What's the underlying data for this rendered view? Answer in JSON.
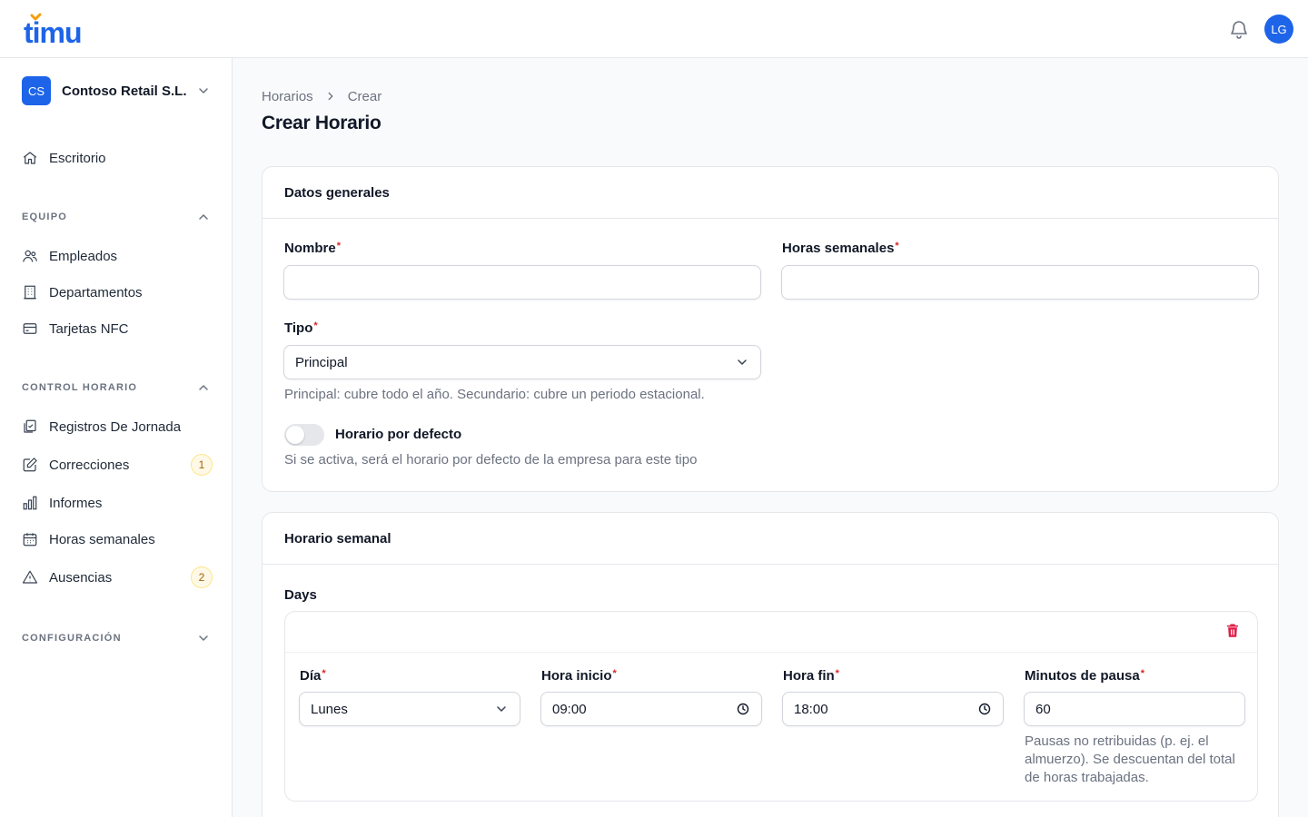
{
  "app": {
    "logo_text": "timu",
    "user_initials": "LG"
  },
  "sidebar": {
    "company": {
      "initials": "CS",
      "name": "Contoso Retail S.L."
    },
    "top_items": [
      {
        "label": "Escritorio",
        "icon": "home-icon"
      }
    ],
    "sections": [
      {
        "title": "EQUIPO",
        "expanded": true,
        "items": [
          {
            "label": "Empleados",
            "icon": "users-icon"
          },
          {
            "label": "Departamentos",
            "icon": "building-icon"
          },
          {
            "label": "Tarjetas NFC",
            "icon": "credit-card-icon"
          }
        ]
      },
      {
        "title": "CONTROL HORARIO",
        "expanded": true,
        "items": [
          {
            "label": "Registros De Jornada",
            "icon": "clipboard-check-icon"
          },
          {
            "label": "Correcciones",
            "icon": "pencil-square-icon",
            "badge": "1"
          },
          {
            "label": "Informes",
            "icon": "bar-chart-icon"
          },
          {
            "label": "Horas semanales",
            "icon": "calendar-icon"
          },
          {
            "label": "Ausencias",
            "icon": "warning-triangle-icon",
            "badge": "2"
          }
        ]
      },
      {
        "title": "CONFIGURACIÓN",
        "expanded": false,
        "items": []
      }
    ]
  },
  "breadcrumb": [
    "Horarios",
    "Crear"
  ],
  "page_title": "Crear Horario",
  "general": {
    "title": "Datos generales",
    "nombre": {
      "label": "Nombre",
      "value": ""
    },
    "horas_semanales": {
      "label": "Horas semanales",
      "value": ""
    },
    "tipo": {
      "label": "Tipo",
      "value": "Principal",
      "help": "Principal: cubre todo el año. Secundario: cubre un periodo estacional."
    },
    "default_toggle": {
      "label": "Horario por defecto",
      "checked": false,
      "help": "Si se activa, será el horario por defecto de la empresa para este tipo"
    }
  },
  "weekly": {
    "title": "Horario semanal",
    "days_label": "Days",
    "day_entry": {
      "dia": {
        "label": "Día",
        "value": "Lunes"
      },
      "hora_inicio": {
        "label": "Hora inicio",
        "value": "09:00"
      },
      "hora_fin": {
        "label": "Hora fin",
        "value": "18:00"
      },
      "minutos_pausa": {
        "label": "Minutos de pausa",
        "value": "60",
        "help": "Pausas no retribuidas (p. ej. el almuerzo). Se descuentan del total de horas trabajadas."
      }
    }
  },
  "colors": {
    "primary": "#1d64e8",
    "required": "#dc2626",
    "danger": "#e11d48"
  }
}
